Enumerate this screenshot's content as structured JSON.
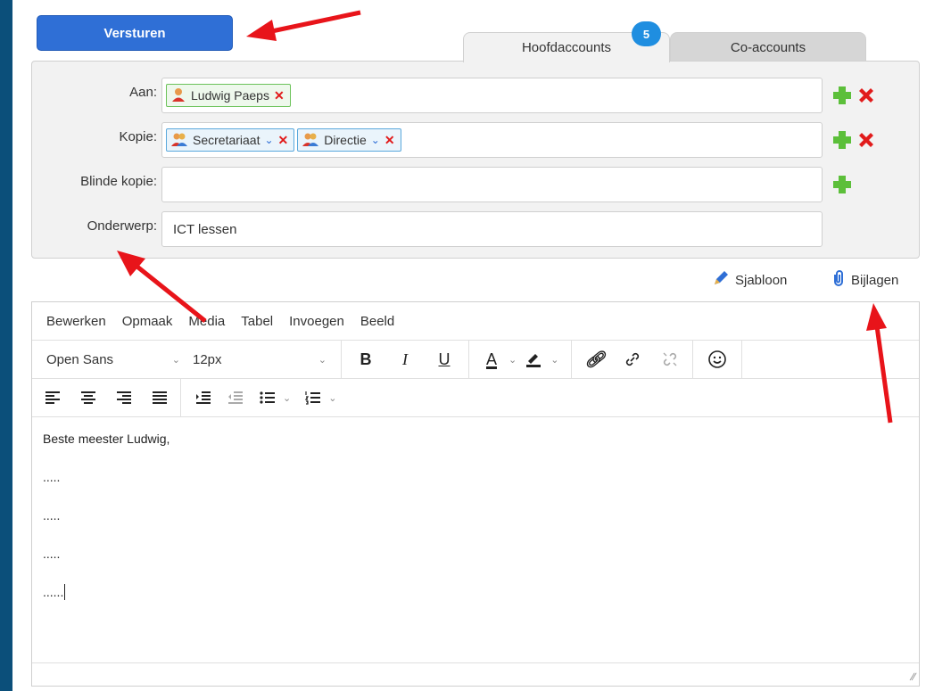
{
  "send_button": {
    "label": "Versturen"
  },
  "tabs": [
    {
      "label": "Hoofdaccounts",
      "active": true
    },
    {
      "label": "Co-accounts",
      "active": false
    }
  ],
  "badge": {
    "count": "5"
  },
  "recipients": {
    "to": {
      "label": "Aan:",
      "chips": [
        {
          "name": "Ludwig Paeps",
          "type": "person"
        }
      ]
    },
    "cc": {
      "label": "Kopie:",
      "chips": [
        {
          "name": "Secretariaat",
          "type": "group"
        },
        {
          "name": "Directie",
          "type": "group"
        }
      ]
    },
    "bcc": {
      "label": "Blinde kopie:",
      "chips": []
    },
    "subject": {
      "label": "Onderwerp:",
      "value": "ICT lessen"
    }
  },
  "links": {
    "template": "Sjabloon",
    "attachments": "Bijlagen"
  },
  "editor": {
    "menu": [
      "Bewerken",
      "Opmaak",
      "Media",
      "Tabel",
      "Invoegen",
      "Beeld"
    ],
    "font_family": "Open Sans",
    "font_size": "12px",
    "toolbar_labels": {
      "bold": "B",
      "italic": "I",
      "underline": "U",
      "text_color": "A"
    },
    "body_lines": [
      "Beste meester Ludwig,",
      ".....",
      ".....",
      ".....",
      "......"
    ]
  },
  "colors": {
    "send_button": "#2f6fd6",
    "badge": "#1f8ee0",
    "plus": "#5cbf3a",
    "remove": "#e11b1b",
    "annotation_arrow": "#e8141a"
  }
}
